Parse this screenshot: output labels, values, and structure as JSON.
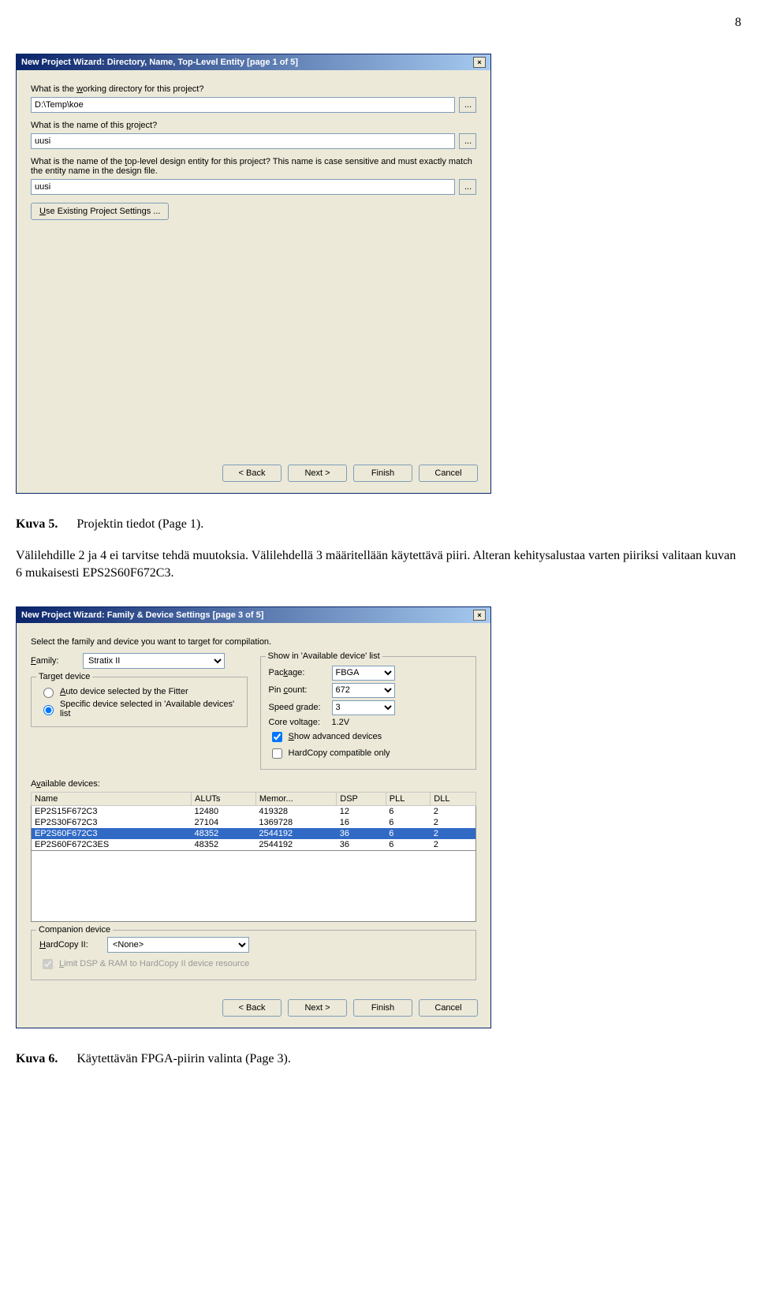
{
  "page_number": "8",
  "dialog1": {
    "title": "New Project Wizard: Directory, Name, Top-Level Entity [page 1 of 5]",
    "close": "×",
    "prompt_dir": "What is the working directory for this project?",
    "dir_value": "D:\\Temp\\koe",
    "prompt_name": "What is the name of this project?",
    "name_value": "uusi",
    "prompt_top": "What is the name of the top-level design entity for this project? This name is case sensitive and must exactly match the entity name in the design file.",
    "top_value": "uusi",
    "existing_btn": "Use Existing Project Settings ...",
    "browse_label": "...",
    "back": "< Back",
    "next": "Next >",
    "finish": "Finish",
    "cancel": "Cancel"
  },
  "caption5_label": "Kuva 5.",
  "caption5_text": "Projektin tiedot (Page 1).",
  "body_paragraph": "Välilehdille 2 ja 4 ei tarvitse tehdä muutoksia. Välilehdellä 3 määritellään käytettävä piiri. Alteran kehitysalustaa varten piiriksi valitaan kuvan 6 mukaisesti EPS2S60F672C3.",
  "dialog2": {
    "title": "New Project Wizard: Family & Device Settings [page 3 of 5]",
    "intro": "Select the family and device you want to target for compilation.",
    "family_label": "Family:",
    "family_value": "Stratix II",
    "target_group": "Target device",
    "radio_auto": "Auto device selected by the Fitter",
    "radio_specific": "Specific device selected in 'Available devices' list",
    "show_group": "Show in 'Available device' list",
    "package_label": "Package:",
    "package_value": "FBGA",
    "pin_label": "Pin count:",
    "pin_value": "672",
    "speed_label": "Speed grade:",
    "speed_value": "3",
    "core_label": "Core voltage:",
    "core_value": "1.2V",
    "show_advanced": "Show advanced devices",
    "hardcopy_compat": "HardCopy compatible only",
    "available_label": "Available devices:",
    "cols": [
      "Name",
      "ALUTs",
      "Memor...",
      "DSP",
      "PLL",
      "DLL"
    ],
    "rows": [
      [
        "EP2S15F672C3",
        "12480",
        "419328",
        "12",
        "6",
        "2"
      ],
      [
        "EP2S30F672C3",
        "27104",
        "1369728",
        "16",
        "6",
        "2"
      ],
      [
        "EP2S60F672C3",
        "48352",
        "2544192",
        "36",
        "6",
        "2"
      ],
      [
        "EP2S60F672C3ES",
        "48352",
        "2544192",
        "36",
        "6",
        "2"
      ]
    ],
    "selected_row": 2,
    "companion_group": "Companion device",
    "hardcopy2_label": "HardCopy II:",
    "hardcopy2_value": "<None>",
    "limit_label": "Limit DSP & RAM to HardCopy II device resource",
    "back": "< Back",
    "next": "Next >",
    "finish": "Finish",
    "cancel": "Cancel"
  },
  "caption6_label": "Kuva 6.",
  "caption6_text": "Käytettävän FPGA-piirin valinta (Page 3)."
}
